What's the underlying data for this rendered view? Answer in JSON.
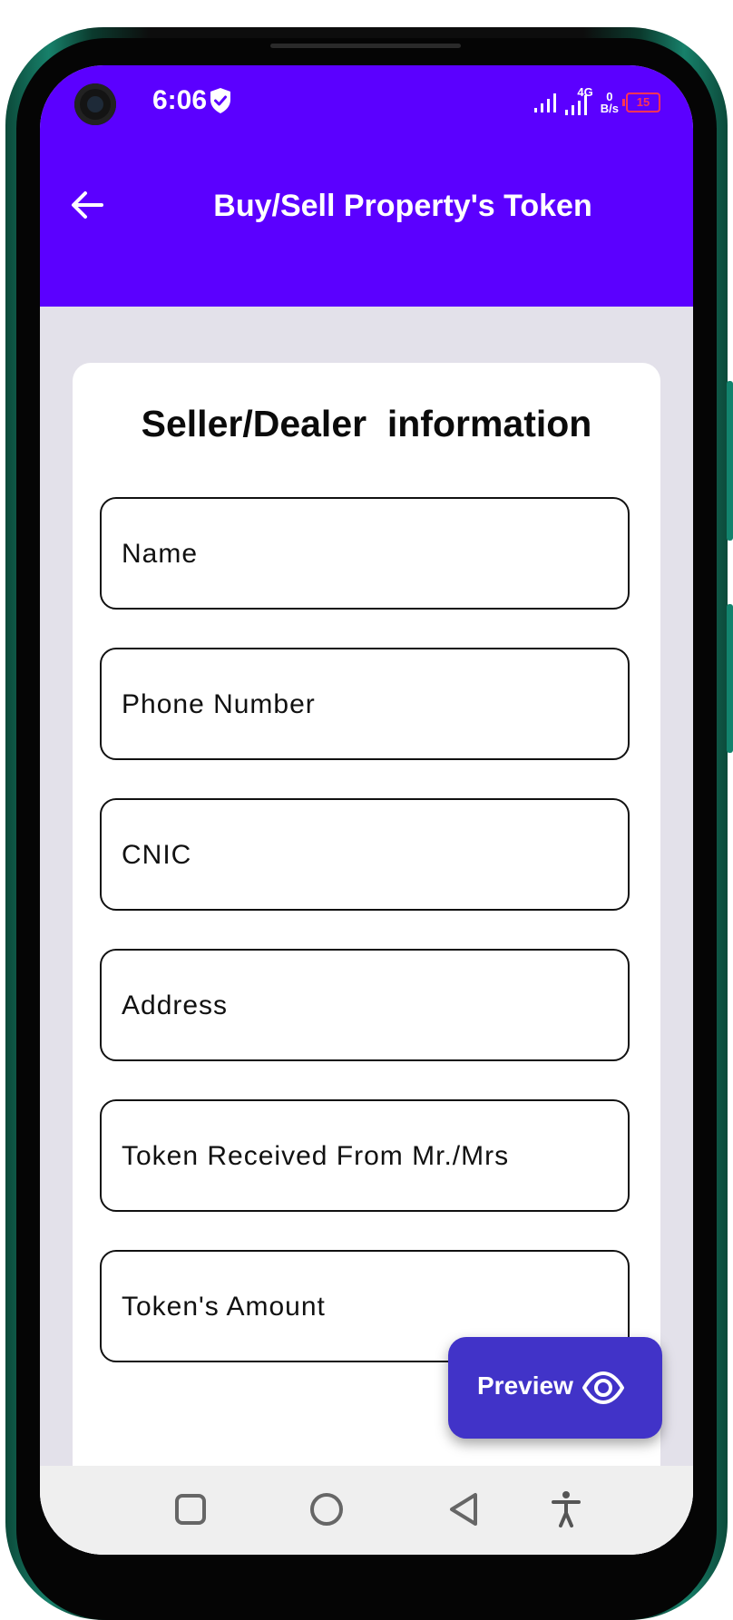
{
  "status_bar": {
    "time": "6:06",
    "network_type": "4G",
    "data_speed_value": "0",
    "data_speed_unit": "B/s",
    "battery": "15"
  },
  "app_bar": {
    "title": "Buy/Sell Property's Token",
    "back_icon": "arrow-left-icon"
  },
  "form": {
    "title": "Seller/Dealer  information",
    "fields": [
      {
        "label": "Name"
      },
      {
        "label": "Phone Number"
      },
      {
        "label": "CNIC"
      },
      {
        "label": "Address"
      },
      {
        "label": "Token Received From Mr./Mrs"
      },
      {
        "label": "Token's Amount"
      }
    ]
  },
  "fab": {
    "label": "Preview",
    "icon": "eye-icon"
  },
  "nav_bar": {
    "items": [
      "recents-icon",
      "home-icon",
      "back-icon",
      "accessibility-icon"
    ]
  },
  "colors": {
    "brand": "#5b00ff",
    "fab": "#4133c8",
    "background": "#e3e1ea"
  }
}
